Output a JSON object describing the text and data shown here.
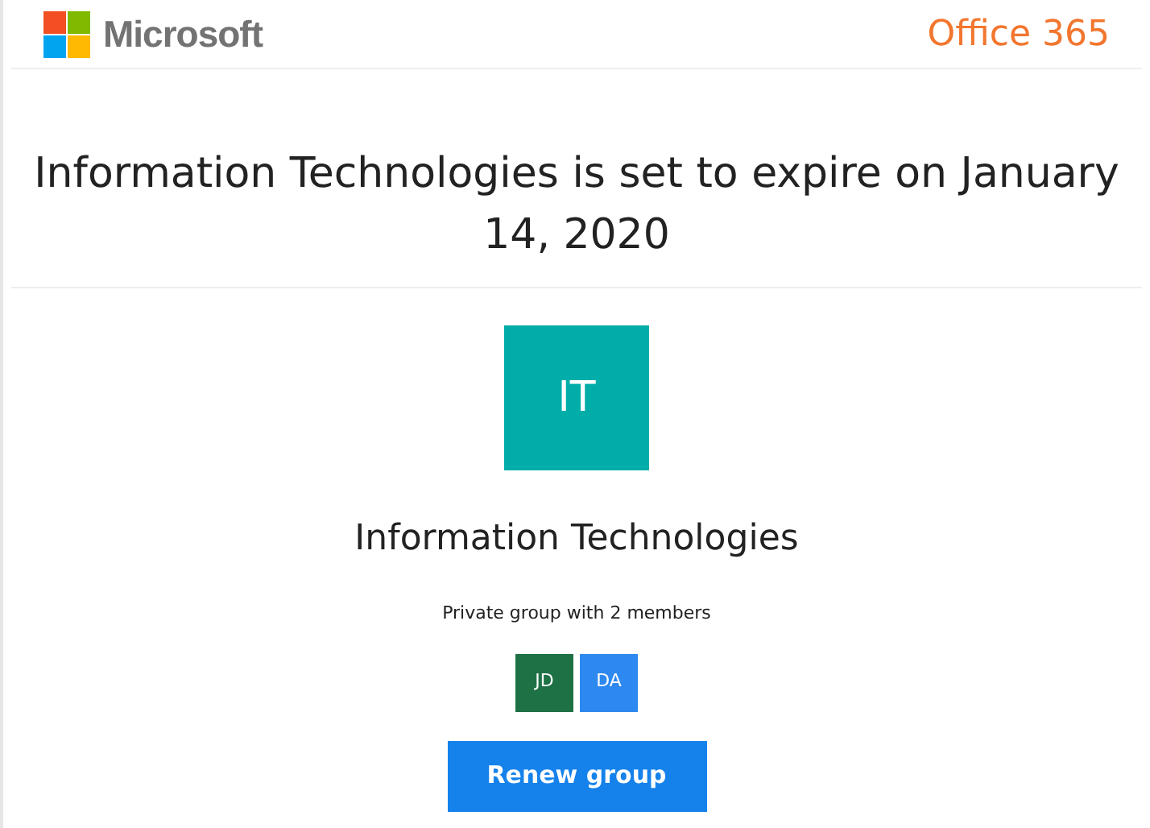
{
  "header": {
    "brand": "Microsoft",
    "product": "Office 365"
  },
  "title": "Information Technologies is set to expire on January 14, 2020",
  "group": {
    "initials": "IT",
    "name": "Information Technologies",
    "description": "Private group with 2 members",
    "members": [
      {
        "initials": "JD",
        "color": "#1e7145"
      },
      {
        "initials": "DA",
        "color": "#2d89ef"
      }
    ]
  },
  "buttons": [
    "Renew group"
  ]
}
